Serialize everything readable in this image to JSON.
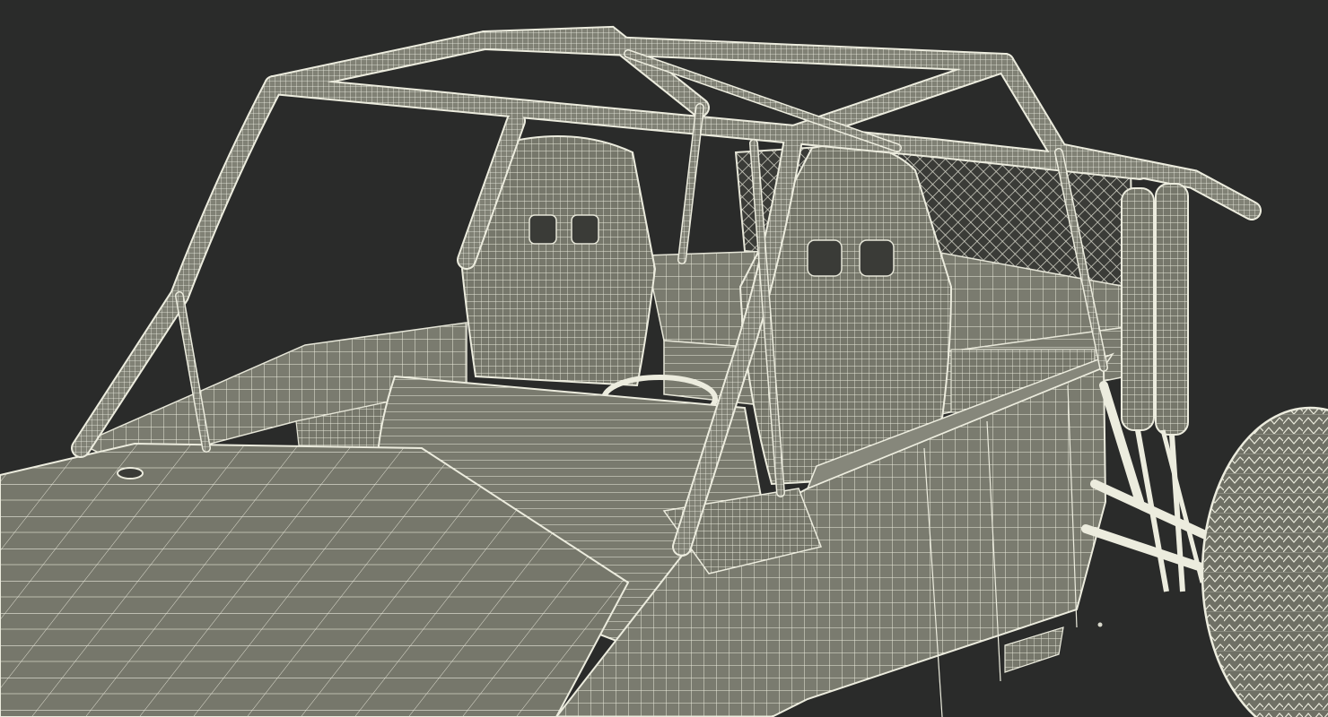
{
  "scene": {
    "background_color": "#2a2b2a",
    "mesh_fill_color": "#75766a",
    "mesh_wire_color": "#eeeee0",
    "subject": "buggy-wireframe-render"
  }
}
